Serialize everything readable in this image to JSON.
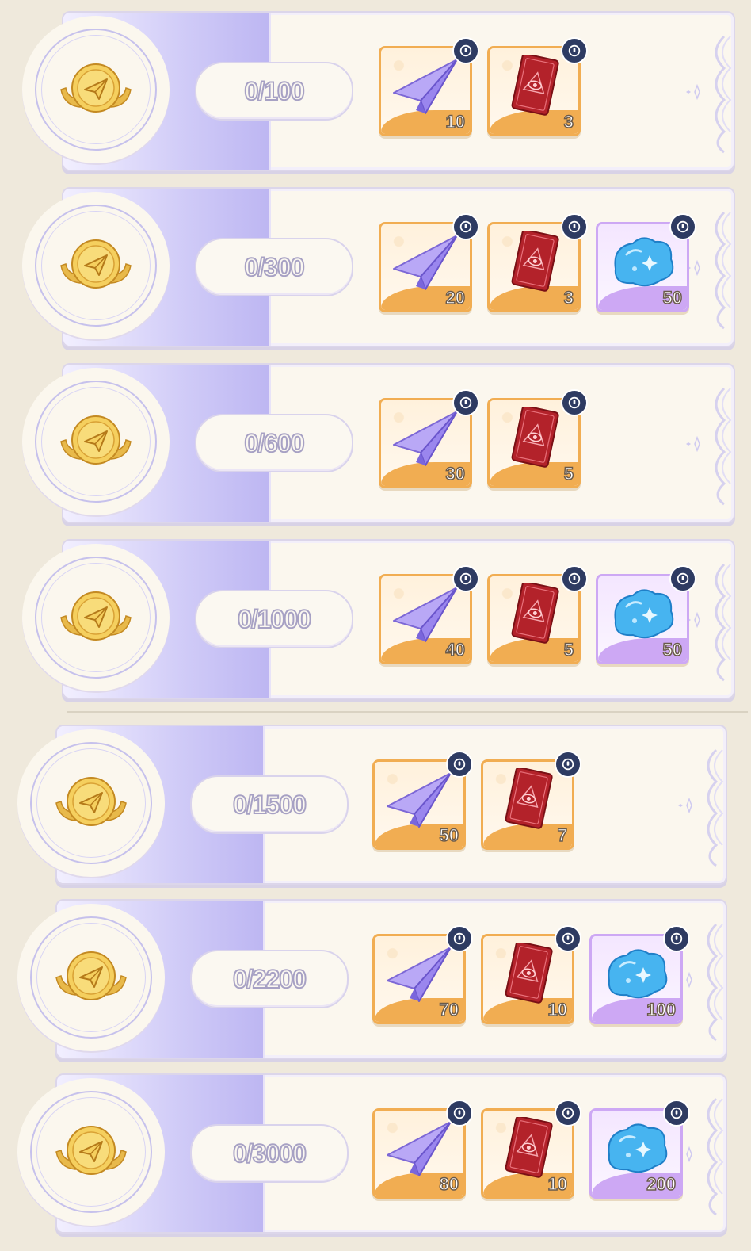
{
  "tiers": [
    {
      "progress": "0/100",
      "rewards": [
        {
          "type": "plane",
          "qty": "10"
        },
        {
          "type": "card",
          "qty": "3"
        }
      ]
    },
    {
      "progress": "0/300",
      "rewards": [
        {
          "type": "plane",
          "qty": "20"
        },
        {
          "type": "card",
          "qty": "3"
        },
        {
          "type": "slime",
          "qty": "50"
        }
      ]
    },
    {
      "progress": "0/600",
      "rewards": [
        {
          "type": "plane",
          "qty": "30"
        },
        {
          "type": "card",
          "qty": "5"
        }
      ]
    },
    {
      "progress": "0/1000",
      "rewards": [
        {
          "type": "plane",
          "qty": "40"
        },
        {
          "type": "card",
          "qty": "5"
        },
        {
          "type": "slime",
          "qty": "50"
        }
      ]
    },
    {
      "progress": "0/1500",
      "rewards": [
        {
          "type": "plane",
          "qty": "50"
        },
        {
          "type": "card",
          "qty": "7"
        }
      ]
    },
    {
      "progress": "0/2200",
      "rewards": [
        {
          "type": "plane",
          "qty": "70"
        },
        {
          "type": "card",
          "qty": "10"
        },
        {
          "type": "slime",
          "qty": "100"
        }
      ]
    },
    {
      "progress": "0/3000",
      "rewards": [
        {
          "type": "plane",
          "qty": "80"
        },
        {
          "type": "card",
          "qty": "10"
        },
        {
          "type": "slime",
          "qty": "200"
        }
      ]
    }
  ],
  "icons": {
    "medal": "gold-winged-paper-plane-medal-icon",
    "plane": "paper-plane-icon",
    "card": "red-eye-card-icon",
    "slime": "blue-crystal-slime-icon",
    "lock": "lock-icon"
  },
  "colors": {
    "orange_frame": "#f1ad52",
    "purple_frame": "#cda8f4",
    "band": "#bdb6f2",
    "lock": "#2e3b62"
  }
}
